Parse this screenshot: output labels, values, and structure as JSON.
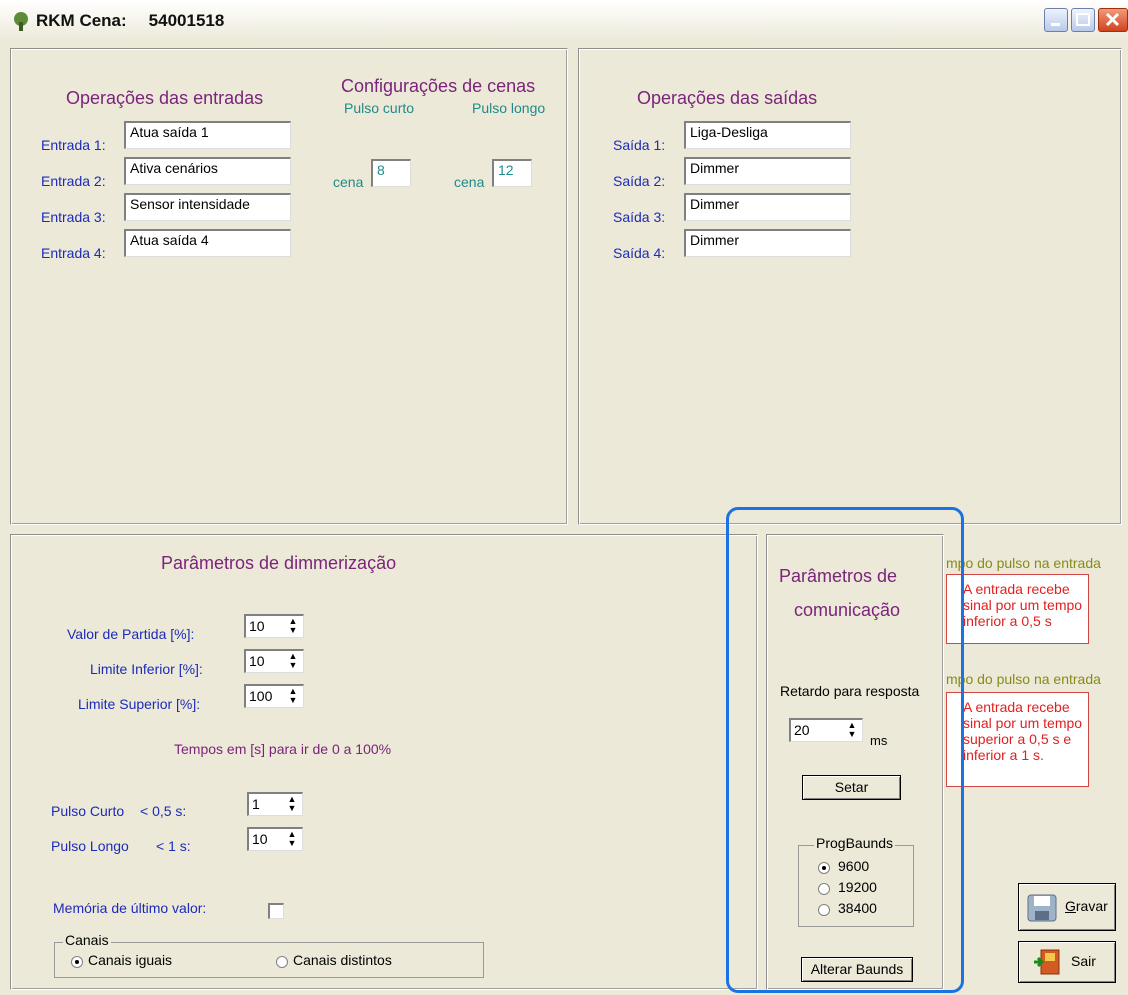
{
  "window": {
    "title": "RKM Cena:",
    "serial": "54001518"
  },
  "inputs": {
    "heading": "Operações das entradas",
    "rows": [
      {
        "label": "Entrada 1:",
        "value": "Atua saída 1"
      },
      {
        "label": "Entrada 2:",
        "value": "Ativa cenários"
      },
      {
        "label": "Entrada 3:",
        "value": "Sensor intensidade"
      },
      {
        "label": "Entrada 4:",
        "value": "Atua saída 4"
      }
    ]
  },
  "scenes": {
    "heading": "Configurações de cenas",
    "short_label": "Pulso curto",
    "long_label": "Pulso longo",
    "cena_label": "cena",
    "short_value": "8",
    "long_value": "12"
  },
  "outputs": {
    "heading": "Operações das saídas",
    "rows": [
      {
        "label": "Saída 1:",
        "value": "Liga-Desliga"
      },
      {
        "label": "Saída 2:",
        "value": "Dimmer"
      },
      {
        "label": "Saída 3:",
        "value": "Dimmer"
      },
      {
        "label": "Saída 4:",
        "value": "Dimmer"
      }
    ]
  },
  "dimmer": {
    "heading": "Parâmetros de dimmerização",
    "start_label": "Valor de Partida [%]:",
    "start_value": "10",
    "lower_label": "Limite Inferior [%]:",
    "lower_value": "10",
    "upper_label": "Limite Superior [%]:",
    "upper_value": "100",
    "times_label": "Tempos em [s] para ir de 0 a 100%",
    "short_label": "Pulso Curto",
    "short_limit": "< 0,5 s:",
    "short_value": "1",
    "long_label": "Pulso Longo",
    "long_limit": "< 1 s:",
    "long_value": "10",
    "memory_label": "Memória de último valor:",
    "channels_legend": "Canais",
    "channels_equal": "Canais iguais",
    "channels_distinct": "Canais distintos"
  },
  "comm": {
    "heading_line1": "Parâmetros de",
    "heading_line2": "comunicação",
    "delay_label": "Retardo para resposta",
    "delay_value": "20",
    "delay_unit": "ms",
    "set_button": "Setar",
    "baud_legend": "ProgBaunds",
    "bauds": [
      "9600",
      "19200",
      "38400"
    ],
    "change_button": "Alterar Baunds"
  },
  "pulse_info": {
    "title1": "mpo do pulso na entrada",
    "text1": "A entrada recebe sinal por um tempo inferior a 0,5 s",
    "title2": "mpo do pulso na entrada",
    "text2": "A entrada recebe sinal por um tempo superior a 0,5 s  e inferior a 1 s."
  },
  "actions": {
    "save_first": "G",
    "save_rest": "ravar",
    "exit": "Sair"
  },
  "colors": {
    "purple": "#7a247a",
    "teal": "#208a8a",
    "blue": "#1c2bb8",
    "red": "#e02020",
    "highlight": "#1a73e0"
  }
}
